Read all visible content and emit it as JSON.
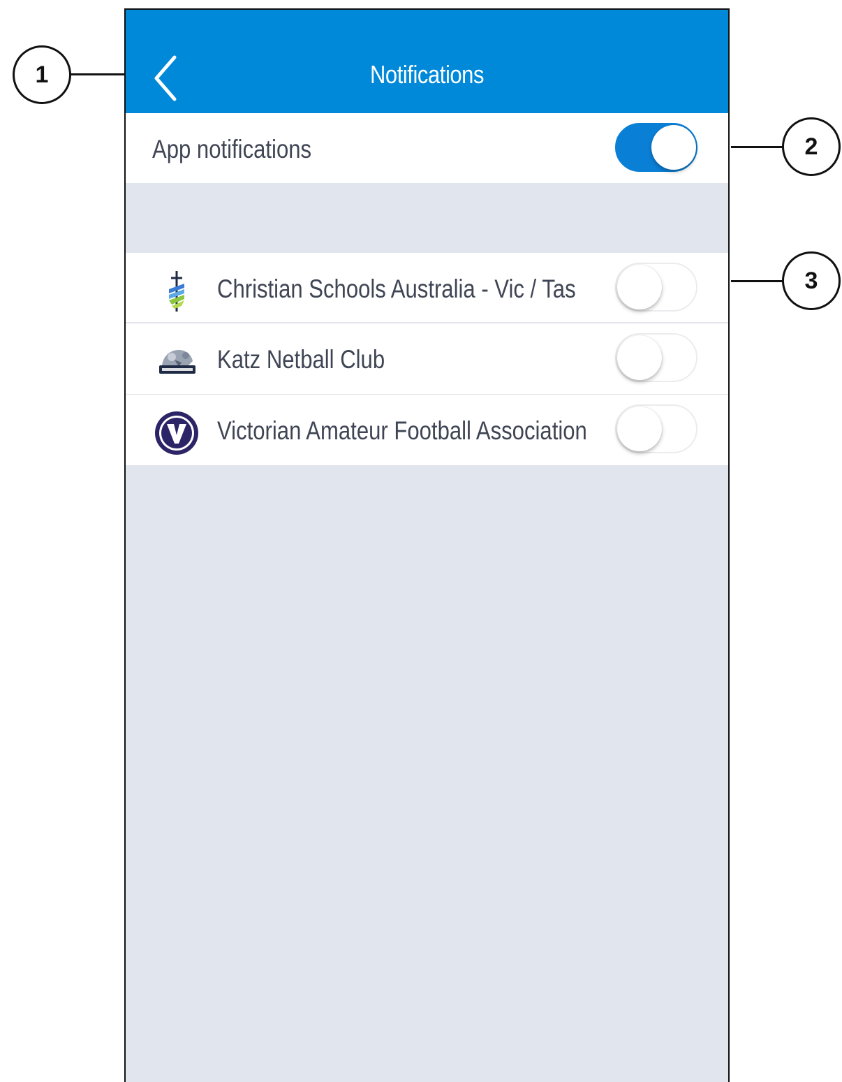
{
  "navbar": {
    "title": "Notifications",
    "color": "#0088d9"
  },
  "app_notifications": {
    "label": "App notifications",
    "enabled": true
  },
  "organisations": [
    {
      "name": "Christian Schools Australia - Vic / Tas",
      "logo": "csa-cross-logo",
      "enabled": false
    },
    {
      "name": "Katz Netball Club",
      "logo": "katz-netball-logo",
      "enabled": false
    },
    {
      "name": "Victorian Amateur Football Association",
      "logo": "vafa-v-logo",
      "enabled": false
    }
  ],
  "callouts": [
    "1",
    "2",
    "3"
  ],
  "colors": {
    "background": "#e1e5ee",
    "toggle_on": "#0a7fd6",
    "text": "#3f4554"
  }
}
